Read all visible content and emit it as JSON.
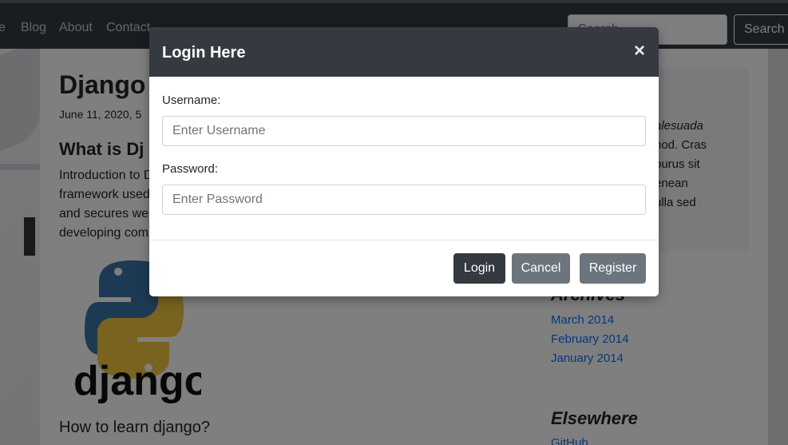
{
  "navbar": {
    "links": [
      "e",
      "Blog",
      "About",
      "Contact"
    ],
    "search_placeholder": "Search",
    "search_button": "Search"
  },
  "post": {
    "title": "Django",
    "date": "June 11, 2020, 5",
    "heading": "What is Dj",
    "paragraph_lines": [
      "Introduction to D",
      "framework used",
      "and secures web",
      "developing com"
    ],
    "subheading": "How to learn django?",
    "logo_text": "django"
  },
  "sidebar": {
    "text_lines": [
      "alesuada",
      "nod. Cras",
      "purus sit",
      "enean",
      "ulla sed"
    ],
    "archives_title": "Archives",
    "archives": [
      "March 2014",
      "February 2014",
      "January 2014"
    ],
    "elsewhere_title": "Elsewhere",
    "github": "GitHub"
  },
  "modal": {
    "title": "Login Here",
    "close_symbol": "×",
    "username_label": "Username:",
    "username_placeholder": "Enter Username",
    "password_label": "Password:",
    "password_placeholder": "Enter Password",
    "login_button": "Login",
    "cancel_button": "Cancel",
    "register_button": "Register"
  },
  "colors": {
    "header_dark": "#343a40",
    "secondary": "#6c757d",
    "link": "#0d6efd"
  }
}
